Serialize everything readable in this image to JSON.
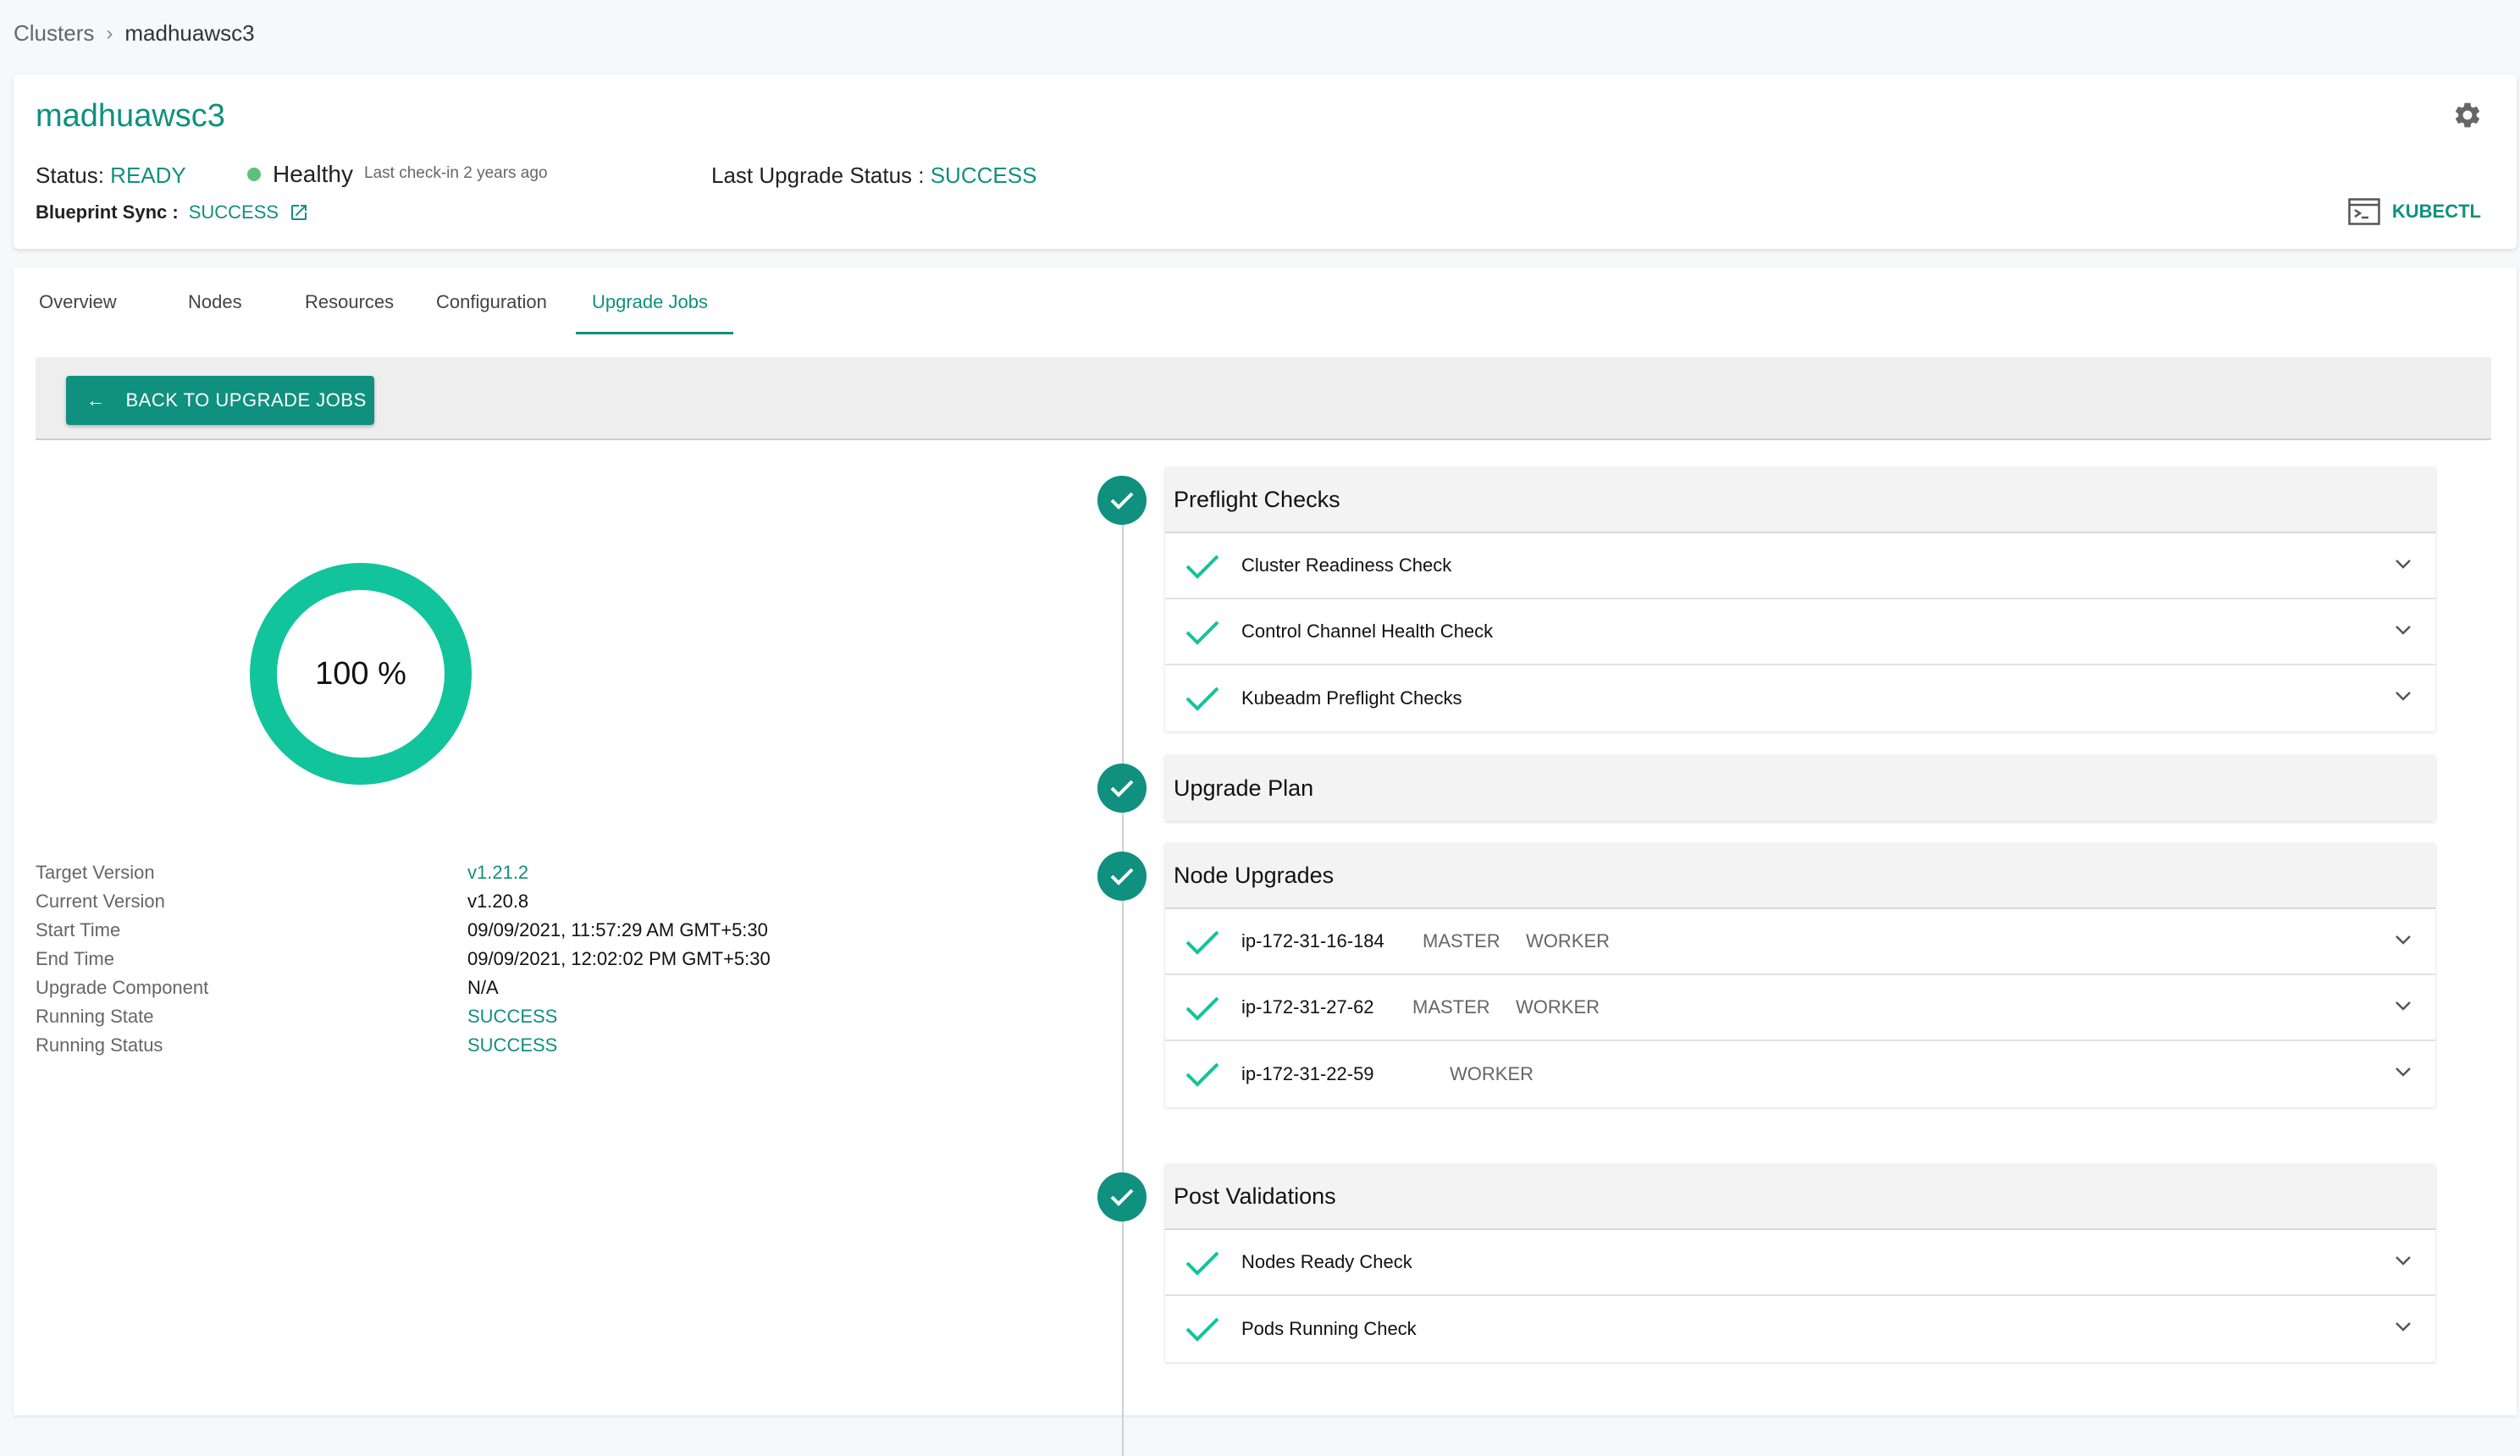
{
  "breadcrumb": {
    "root": "Clusters",
    "separator": "›",
    "current": "madhuawsc3"
  },
  "header": {
    "cluster_name": "madhuawsc3",
    "status_label": "Status:",
    "status_value": "READY",
    "health": "Healthy",
    "last_checkin": "Last check-in 2 years ago",
    "last_upgrade_label": "Last Upgrade Status :",
    "last_upgrade_value": "SUCCESS",
    "blueprint_label": "Blueprint Sync :",
    "blueprint_value": "SUCCESS",
    "kubectl_label": "KUBECTL"
  },
  "tabs": [
    {
      "label": "Overview",
      "active": false
    },
    {
      "label": "Nodes",
      "active": false
    },
    {
      "label": "Resources",
      "active": false
    },
    {
      "label": "Configuration",
      "active": false
    },
    {
      "label": "Upgrade Jobs",
      "active": true
    }
  ],
  "toolbar": {
    "back_label": "BACK TO UPGRADE JOBS",
    "back_icon": "←"
  },
  "progress": {
    "text": "100 %",
    "value": 100
  },
  "details": [
    {
      "key": "Target Version",
      "value": "v1.21.2",
      "accent": true
    },
    {
      "key": "Current Version",
      "value": "v1.20.8",
      "accent": false
    },
    {
      "key": "Start Time",
      "value": "09/09/2021, 11:57:29 AM GMT+5:30",
      "accent": false
    },
    {
      "key": "End Time",
      "value": "09/09/2021, 12:02:02 PM GMT+5:30",
      "accent": false
    },
    {
      "key": "Upgrade Component",
      "value": "N/A",
      "accent": false
    },
    {
      "key": "Running State",
      "value": "SUCCESS",
      "accent": true
    },
    {
      "key": "Running Status",
      "value": "SUCCESS",
      "accent": true
    }
  ],
  "sections": {
    "preflight": {
      "title": "Preflight Checks",
      "items": [
        "Cluster Readiness Check",
        "Control Channel Health Check",
        "Kubeadm Preflight Checks"
      ]
    },
    "upgrade_plan": {
      "title": "Upgrade Plan"
    },
    "node_upgrades": {
      "title": "Node Upgrades",
      "items": [
        {
          "name": "ip-172-31-16-184",
          "role1": "MASTER",
          "role2": "WORKER"
        },
        {
          "name": "ip-172-31-27-62",
          "role1": "MASTER",
          "role2": "WORKER"
        },
        {
          "name": "ip-172-31-22-59",
          "role1": "",
          "role2": "WORKER"
        }
      ]
    },
    "post_validations": {
      "title": "Post Validations",
      "items": [
        "Nodes Ready Check",
        "Pods Running Check"
      ]
    }
  },
  "colors": {
    "accent": "#10907f",
    "progress_ring": "#12c49b",
    "healthy_dot": "#5cc279"
  }
}
